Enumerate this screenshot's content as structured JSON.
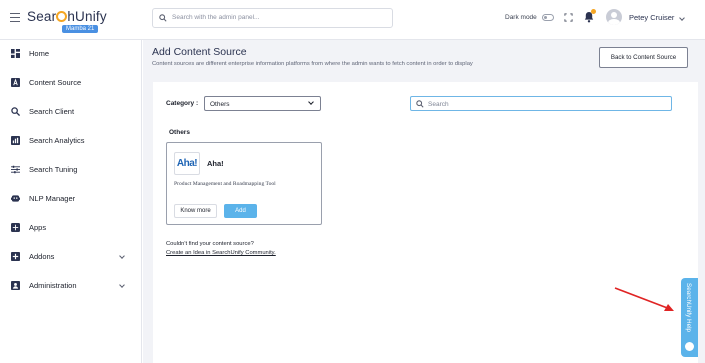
{
  "app": {
    "logo_pre": "Sear",
    "logo_post": "hUnify",
    "version_badge": "Mamba 21",
    "search_placeholder": "Search with the admin panel...",
    "dark_mode_label": "Dark mode",
    "user_name": "Petey Cruiser",
    "accent": "#5bb3ea"
  },
  "sidebar": {
    "items": [
      {
        "label": "Home",
        "icon": "dashboard-icon"
      },
      {
        "label": "Content Source",
        "icon": "content-source-icon"
      },
      {
        "label": "Search Client",
        "icon": "search-icon"
      },
      {
        "label": "Search Analytics",
        "icon": "analytics-icon"
      },
      {
        "label": "Search Tuning",
        "icon": "tuning-icon"
      },
      {
        "label": "NLP Manager",
        "icon": "nlp-icon"
      },
      {
        "label": "Apps",
        "icon": "apps-icon"
      },
      {
        "label": "Addons",
        "icon": "addons-icon"
      },
      {
        "label": "Administration",
        "icon": "administration-icon"
      }
    ]
  },
  "main": {
    "title": "Add Content Source",
    "subtitle": "Content sources are different enterprise information platforms from where the admin wants to fetch content in order to display",
    "back_button": "Back to Content Source",
    "category_label": "Category :",
    "category_value": "Others",
    "search_placeholder": "Search",
    "group_title": "Others",
    "source": {
      "logo_text": "Aha!",
      "name": "Aha!",
      "description": "Product Management and Roadmapping Tool",
      "know_more": "Know more",
      "add": "Add"
    },
    "cant_find": "Couldn't find your content source?",
    "idea_link": "Create an Idea in SearchUnify Community."
  },
  "help": {
    "label": "SearchUnify Help"
  }
}
